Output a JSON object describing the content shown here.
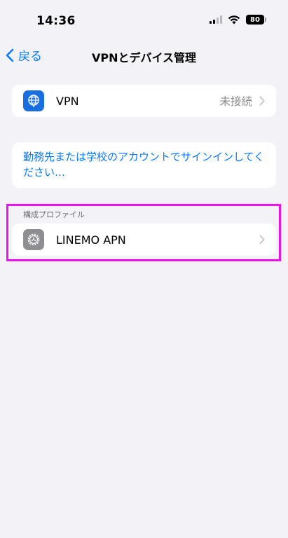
{
  "status_bar": {
    "time": "14:36",
    "battery": "80"
  },
  "nav": {
    "back_label": "戻る",
    "title": "VPNとデバイス管理"
  },
  "vpn_row": {
    "label": "VPN",
    "detail": "未接続"
  },
  "signin": {
    "text": "勤務先または学校のアカウントでサインインしてください…"
  },
  "profiles_section": {
    "header": "構成プロファイル",
    "items": [
      {
        "label": "LINEMO APN"
      }
    ]
  },
  "colors": {
    "accent": "#0a7aff",
    "vpn_icon_bg": "#1a6fe0",
    "profile_icon_bg": "#8e8e93",
    "highlight": "#ee11ee",
    "background": "#f2f2f7"
  },
  "icons": {
    "vpn": "globe-icon",
    "profile": "gear-icon"
  }
}
